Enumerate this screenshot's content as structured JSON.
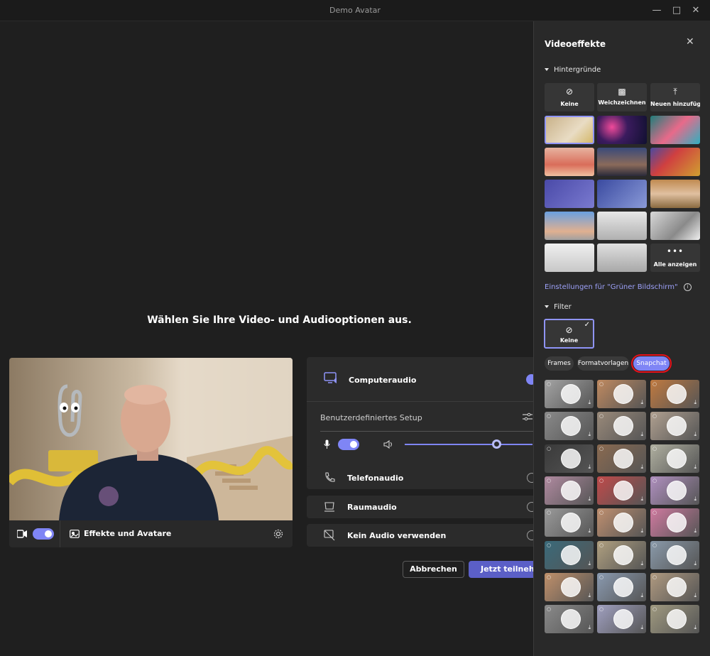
{
  "window": {
    "title": "Demo Avatar"
  },
  "main": {
    "heading": "Wählen Sie Ihre Video- und Audiooptionen aus.",
    "video_bar": {
      "effects_label": "Effekte und Avatare"
    },
    "audio": {
      "computer": "Computeraudio",
      "custom_setup": "Benutzerdefiniertes Setup",
      "phone": "Telefonaudio",
      "room": "Raumaudio",
      "none": "Kein Audio verwenden",
      "volume_level": 0.72
    },
    "buttons": {
      "cancel": "Abbrechen",
      "join": "Jetzt teilnehmen"
    }
  },
  "side": {
    "title": "Videoeffekte",
    "backgrounds_heading": "Hintergründe",
    "bg_options": [
      "Keine",
      "Weichzeichnen",
      "Neuen hinzufügen"
    ],
    "show_all": "Alle anzeigen",
    "green_screen_link": "Einstellungen für \"Grüner Bildschirm\"",
    "filter_heading": "Filter",
    "filter_none": "Keine",
    "filter_tabs": [
      "Frames",
      "Formatvorlagen",
      "Snapchat"
    ],
    "selected_tab": "Snapchat",
    "colors": {
      "accent": "#7f85f5",
      "highlight_ring": "#e8101a"
    }
  }
}
